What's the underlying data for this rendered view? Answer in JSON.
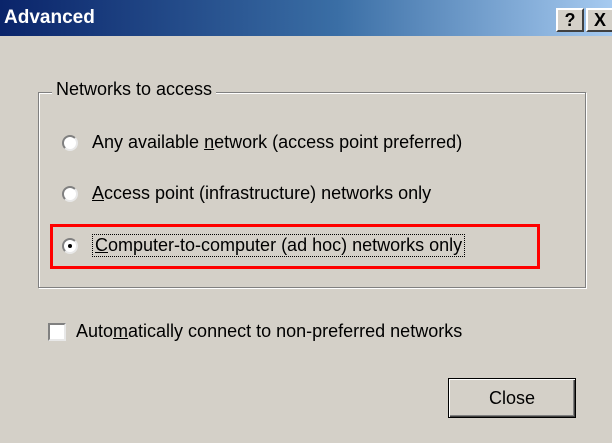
{
  "dialog": {
    "title": "Advanced",
    "help_button": "?",
    "close_button": "X"
  },
  "group": {
    "label": "Networks to access",
    "options": [
      {
        "pre": "Any available ",
        "accel": "n",
        "post": "etwork (access point preferred)",
        "checked": false
      },
      {
        "pre": "",
        "accel": "A",
        "post": "ccess point (infrastructure) networks only",
        "checked": false
      },
      {
        "pre": "",
        "accel": "C",
        "post": "omputer-to-computer (ad hoc) networks only",
        "checked": true
      }
    ]
  },
  "auto_connect": {
    "pre": "Auto",
    "accel": "m",
    "post": "atically connect to non-preferred networks",
    "checked": false
  },
  "buttons": {
    "close_label": "Close"
  },
  "colors": {
    "face": "#d4d0c8",
    "titlebar_start": "#0a246a",
    "highlight": "#ff0000"
  }
}
